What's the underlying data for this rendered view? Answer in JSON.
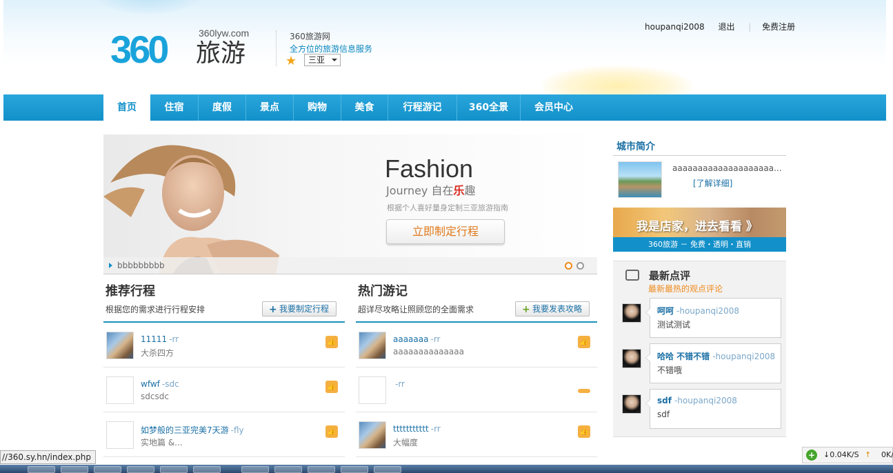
{
  "header": {
    "logo_num": "360",
    "logo_domain": "360lyw.com",
    "logo_cn": "旅游",
    "brand_name": "360旅游网",
    "brand_slogan": "全方位的旅游信息服务",
    "city_selected": "三亚",
    "username": "houpanqi2008",
    "logout": "退出",
    "register": "免费注册"
  },
  "nav": {
    "items": [
      "首页",
      "住宿",
      "度假",
      "景点",
      "购物",
      "美食",
      "行程游记",
      "360全景",
      "会员中心"
    ],
    "active": "首页"
  },
  "banner": {
    "fashion": "Fashion",
    "journey": "Journey",
    "journey_cn_1": "自在",
    "journey_cn_le": "乐",
    "journey_cn_2": "趣",
    "subtitle": "根据个人喜好量身定制三亚旅游指南",
    "cta": "立即制定行程",
    "caption": "bbbbbbbbb",
    "slides_total": 2,
    "slide_active": 1
  },
  "recommend": {
    "title": "推荐行程",
    "subtitle": "根据您的需求进行行程安排",
    "button": "我要制定行程",
    "items": [
      {
        "title": "11111",
        "by": "-rr",
        "desc": "大杀四方"
      },
      {
        "title": "wfwf",
        "by": "-sdc",
        "desc": "sdcsdc"
      },
      {
        "title": "如梦般的三亚完美7天游",
        "by": "-fly",
        "desc": "实地篇 &..."
      }
    ]
  },
  "hot": {
    "title": "热门游记",
    "subtitle": "超详尽攻略让照顾您的全面需求",
    "button": "我要发表攻略",
    "items": [
      {
        "title": "aaaaaaa",
        "by": "-rr",
        "desc": "aaaaaaaaaaaaaa"
      },
      {
        "title": "",
        "by": "-rr",
        "desc": ""
      },
      {
        "title": "ttttttttttt",
        "by": "-rr",
        "desc": "大幅度"
      }
    ]
  },
  "sidebar": {
    "city_title": "城市简介",
    "city_text": "aaaaaaaaaaaaaaaaaaaa...",
    "city_more": "[了解详细]",
    "shop_title": "我是店家，进去看看 》",
    "shop_bar": "360旅游 － 免费・透明・直销",
    "review_title": "最新点评",
    "review_sub": "最新最热的观点评论",
    "reviews": [
      {
        "title": "呵呵",
        "by": "-houpanqi2008",
        "text": "测试测试"
      },
      {
        "title": "哈哈 不错不错",
        "by": "-houpanqi2008",
        "text": "不错哦"
      },
      {
        "title": "sdf",
        "by": "-houpanqi2008",
        "text": "sdf"
      }
    ]
  },
  "status": {
    "url": "//360.sy.hn/index.php",
    "down": "↓0.04K/S",
    "up_arrow": "↑",
    "up": "0K/"
  },
  "colors": {
    "nav_blue": "#1290c9",
    "link_blue": "#1a6fa5",
    "accent_orange": "#f08a1b"
  }
}
